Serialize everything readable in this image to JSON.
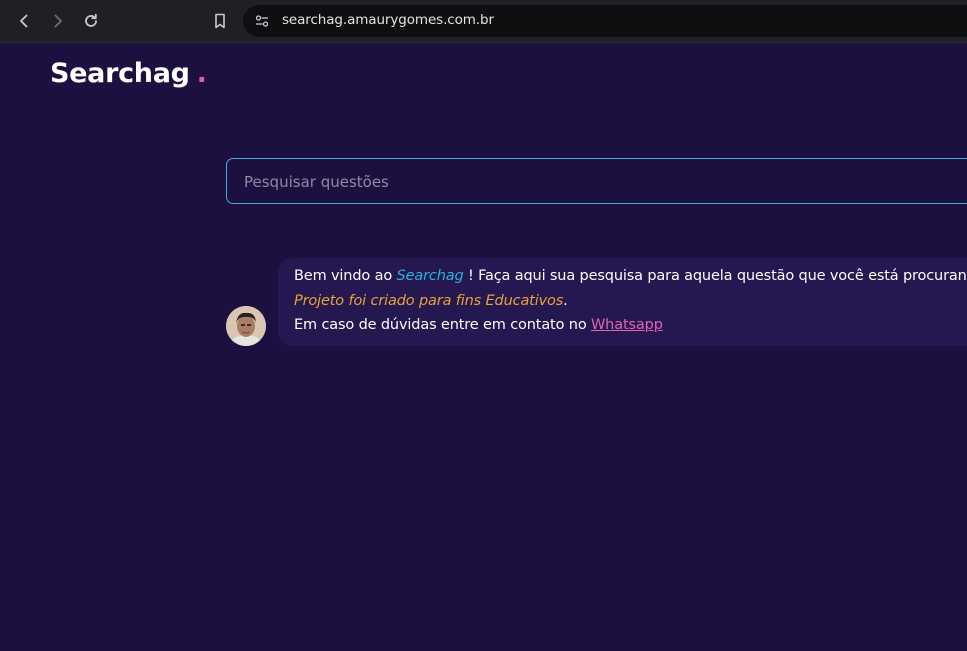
{
  "browser": {
    "url": "searchag.amaurygomes.com.br"
  },
  "header": {
    "logo_text": "Searchag",
    "logo_dot": "."
  },
  "search": {
    "placeholder": "Pesquisar questões",
    "value": ""
  },
  "welcome": {
    "line1_prefix": "Bem vindo ao ",
    "line1_brand": "Searchag",
    "line1_suffix": " ! Faça aqui sua pesquisa para aquela questão que você está procurando",
    "line2_italic": "Projeto foi criado para fins Educativos",
    "line2_period": ".",
    "line3_prefix": "Em caso de dúvidas entre em contato no ",
    "line3_link": "Whatsapp"
  },
  "colors": {
    "background": "#1c1040",
    "bubble": "#25174f",
    "accent_pink": "#e05aa8",
    "accent_cyan": "#27b3d8",
    "accent_orange": "#e8a23a",
    "search_border": "#4ba8d8"
  },
  "icons": {
    "back": "arrow-left-icon",
    "forward": "arrow-right-icon",
    "reload": "reload-icon",
    "bookmark": "bookmark-icon",
    "site_info": "tune-icon"
  }
}
